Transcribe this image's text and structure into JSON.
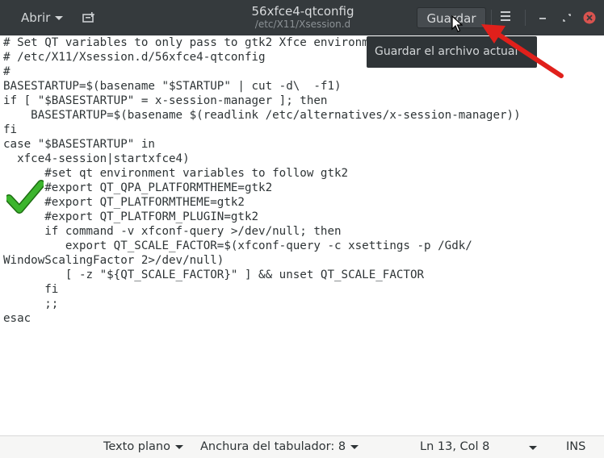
{
  "header": {
    "open_label": "Abrir",
    "title": "56xfce4-qtconfig",
    "subtitle": "/etc/X11/Xsession.d",
    "save_label": "Guardar"
  },
  "tooltip": {
    "text": "Guardar el archivo actual"
  },
  "editor": {
    "text": "# Set QT variables to only pass to gtk2 Xfce environment\n# /etc/X11/Xsession.d/56xfce4-qtconfig\n#\nBASESTARTUP=$(basename \"$STARTUP\" | cut -d\\  -f1)\nif [ \"$BASESTARTUP\" = x-session-manager ]; then\n    BASESTARTUP=$(basename $(readlink /etc/alternatives/x-session-manager))\nfi\ncase \"$BASESTARTUP\" in\n  xfce4-session|startxfce4)\n      #set qt environment variables to follow gtk2\n      #export QT_QPA_PLATFORMTHEME=gtk2\n      #export QT_PLATFORMTHEME=gtk2\n      #export QT_PLATFORM_PLUGIN=gtk2\n      if command -v xfconf-query >/dev/null; then\n         export QT_SCALE_FACTOR=$(xfconf-query -c xsettings -p /Gdk/\nWindowScalingFactor 2>/dev/null)\n         [ -z \"${QT_SCALE_FACTOR}\" ] && unset QT_SCALE_FACTOR\n      fi\n      ;;\nesac"
  },
  "statusbar": {
    "language": "Texto plano",
    "tab_width": "Anchura del tabulador: 8",
    "position": "Ln 13, Col 8",
    "mode": "INS"
  },
  "colors": {
    "titlebar": "#353a3d",
    "close": "#d9534f",
    "annotation_arrow": "#e0201b",
    "checkmark": "#3cb52d"
  },
  "icons": [
    "new-document-icon",
    "hamburger-menu-icon",
    "minimize-icon",
    "maximize-icon",
    "close-icon",
    "red-arrow-annotation",
    "green-checkmark-annotation",
    "mouse-pointer-icon"
  ]
}
